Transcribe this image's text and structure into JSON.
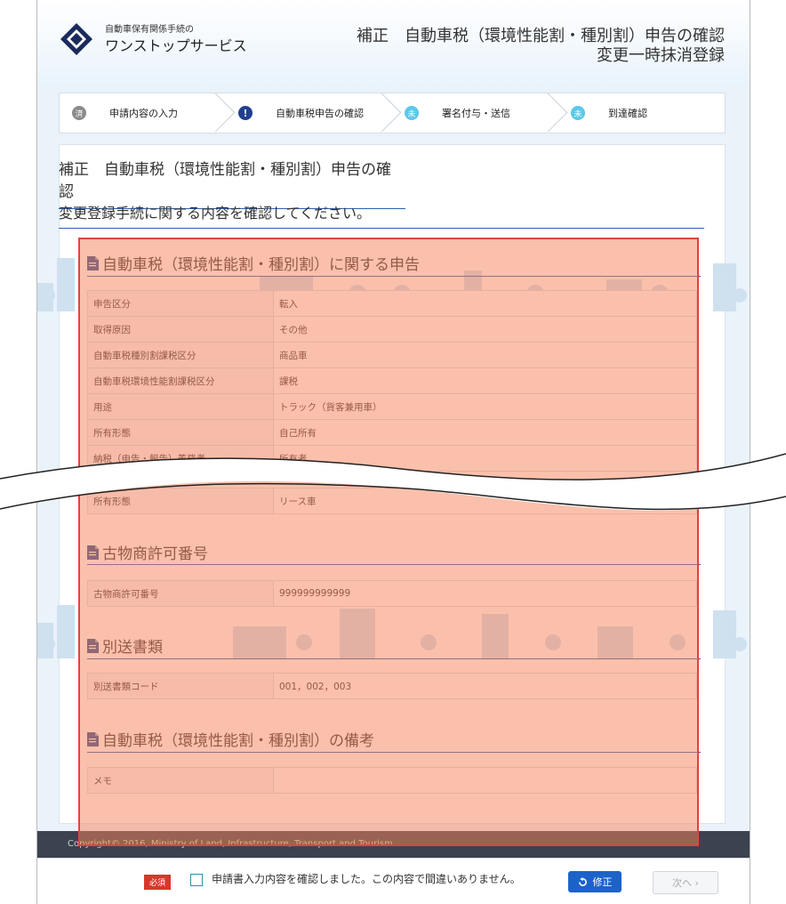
{
  "header": {
    "logo_small": "自動車保有関係手続の",
    "logo_big": "ワンストップサービス",
    "title_line1": "補正　自動車税（環境性能割・種別割）申告の確認",
    "title_line2": "変更一時抹消登録"
  },
  "steps": [
    {
      "icon": "済",
      "label": "申請内容の入力"
    },
    {
      "icon": "!",
      "label": "自動車税申告の確認"
    },
    {
      "icon": "未",
      "label": "署名付与・送信"
    },
    {
      "icon": "未",
      "label": "到達確認"
    }
  ],
  "main": {
    "heading": "補正　自動車税（環境性能割・種別割）申告の確認",
    "instruction": "変更登録手続に関する内容を確認してください。"
  },
  "sections": {
    "tax": {
      "title": "自動車税（環境性能割・種別割）に関する申告",
      "rows": [
        {
          "k": "申告区分",
          "v": "転入"
        },
        {
          "k": "取得原因",
          "v": "その他"
        },
        {
          "k": "自動車税種別割課税区分",
          "v": "商品車"
        },
        {
          "k": "自動車税環境性能割課税区分",
          "v": "課税"
        },
        {
          "k": "用途",
          "v": "トラック（貨客兼用車）"
        },
        {
          "k": "所有形態",
          "v": "自己所有"
        },
        {
          "k": "納税（申告・報告）義務者",
          "v": "所有者"
        }
      ],
      "after_break_row": {
        "k": "所有形態",
        "v": "リース車"
      }
    },
    "antique": {
      "title": "古物商許可番号",
      "rows": [
        {
          "k": "古物商許可番号",
          "v": "999999999999"
        }
      ]
    },
    "separate": {
      "title": "別送書類",
      "rows": [
        {
          "k": "別送書類コード",
          "v": "001，002，003"
        }
      ]
    },
    "remarks": {
      "title": "自動車税（環境性能割・種別割）の備考",
      "rows": [
        {
          "k": "メモ",
          "v": ""
        }
      ]
    }
  },
  "footer": {
    "copyright": "Copyright© 2016, Ministry of Land, Infrastructure, Transport and Tourism"
  },
  "actions": {
    "required_badge": "必須",
    "confirm_label": "申請書入力内容を確認しました。この内容で間違いありません。",
    "fix_button": "修正",
    "next_button": "次へ ›"
  },
  "colors": {
    "accent": "#2a63b0",
    "primary_button": "#1c63c9",
    "required": "#d9362b",
    "highlight_border": "#e0453a"
  }
}
